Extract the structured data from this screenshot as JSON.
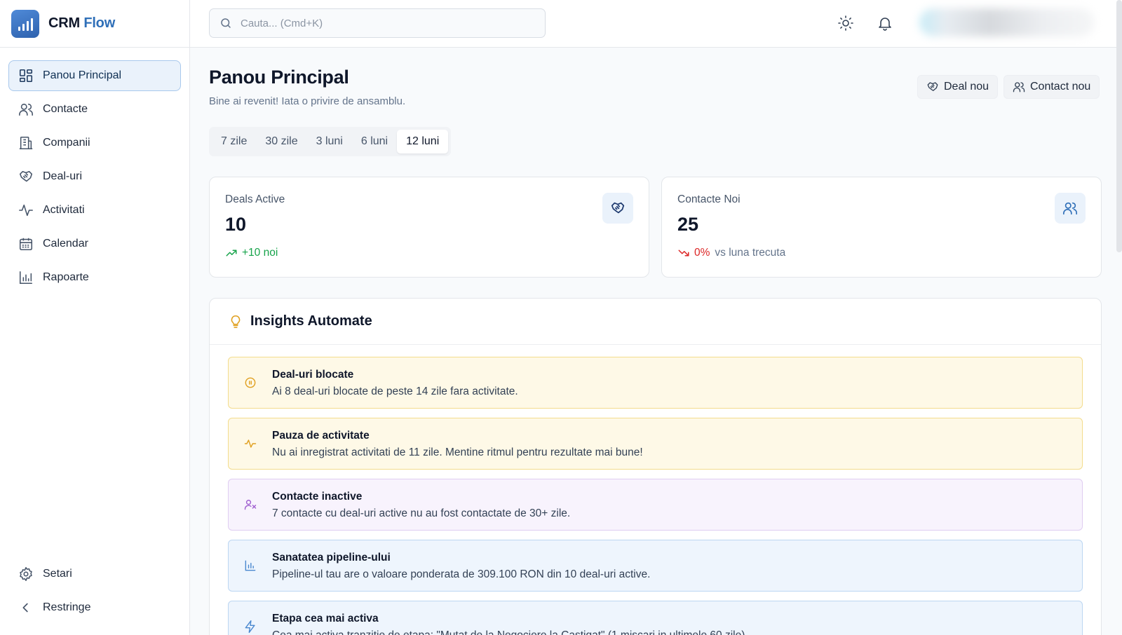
{
  "brand": {
    "name": "CRM",
    "accent": "Flow"
  },
  "sidebar": {
    "items": [
      {
        "label": "Panou Principal",
        "icon": "dashboard-grid-icon",
        "active": true
      },
      {
        "label": "Contacte",
        "icon": "users-icon"
      },
      {
        "label": "Companii",
        "icon": "building-icon"
      },
      {
        "label": "Deal-uri",
        "icon": "handshake-icon"
      },
      {
        "label": "Activitati",
        "icon": "activity-pulse-icon"
      },
      {
        "label": "Calendar",
        "icon": "calendar-icon"
      },
      {
        "label": "Rapoarte",
        "icon": "bar-chart-icon"
      }
    ],
    "bottom": [
      {
        "label": "Setari",
        "icon": "gear-icon"
      },
      {
        "label": "Restringe",
        "icon": "chevron-left-icon"
      }
    ]
  },
  "topbar": {
    "search_placeholder": "Cauta... (Cmd+K)",
    "theme_icon": "sun-icon",
    "notifications_icon": "bell-icon"
  },
  "header": {
    "title": "Panou Principal",
    "subtitle": "Bine ai revenit! Iata o privire de ansamblu.",
    "new_deal_label": "Deal nou",
    "new_contact_label": "Contact nou"
  },
  "periods": {
    "options": [
      "7 zile",
      "30 zile",
      "3 luni",
      "6 luni",
      "12 luni"
    ],
    "selected": "12 luni"
  },
  "stats": {
    "deals": {
      "label": "Deals Active",
      "value": "10",
      "trend": "+10 noi",
      "trend_color": "#16a34a",
      "icon": "handshake-icon"
    },
    "contacts": {
      "label": "Contacte Noi",
      "value": "25",
      "trend_value": "0%",
      "trend_suffix": "vs luna trecuta",
      "trend_color": "#dc2626",
      "icon": "users-icon"
    }
  },
  "insights": {
    "title": "Insights Automate",
    "icon": "lightbulb-icon",
    "items": [
      {
        "title": "Deal-uri blocate",
        "desc": "Ai 8 deal-uri blocate de peste 14 zile fara activitate.",
        "tone": "amber",
        "icon": "pause-circle-icon"
      },
      {
        "title": "Pauza de activitate",
        "desc": "Nu ai inregistrat activitati de 11 zile. Mentine ritmul pentru rezultate mai bune!",
        "tone": "amber",
        "icon": "activity-pulse-icon"
      },
      {
        "title": "Contacte inactive",
        "desc": "7 contacte cu deal-uri active nu au fost contactate de 30+ zile.",
        "tone": "purple",
        "icon": "user-x-icon"
      },
      {
        "title": "Sanatatea pipeline-ului",
        "desc": "Pipeline-ul tau are o valoare ponderata de 309.100 RON din 10 deal-uri active.",
        "tone": "blue",
        "icon": "bar-chart-icon"
      },
      {
        "title": "Etapa cea mai activa",
        "desc": "Cea mai activa tranzitie de etapa: \"Mutat de la Negociere la Castigat\" (1 miscari in ultimele 60 zile)",
        "tone": "blue",
        "icon": "lightning-icon"
      }
    ]
  },
  "colors": {
    "brand": "#2f6fb8",
    "active_bg": "#eaf2fb",
    "amber": "#e0a020",
    "purple": "#a060d0",
    "blue": "#4a88cf"
  }
}
